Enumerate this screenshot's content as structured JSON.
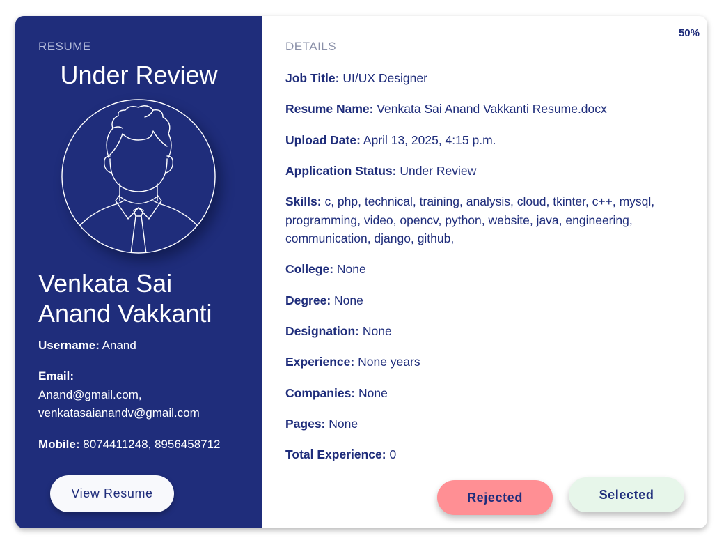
{
  "left_panel": {
    "section_label": "RESUME",
    "status_title": "Under Review",
    "avatar_icon": "person-avatar-icon",
    "full_name": "Venkata Sai Anand Vakkanti",
    "username_label": "Username:",
    "username_value": "Anand",
    "email_label": "Email:",
    "email_value": "Anand@gmail.com, venkatasaianandv@gmail.com",
    "mobile_label": "Mobile:",
    "mobile_value": "8074411248, 8956458712",
    "view_resume_label": "View Resume"
  },
  "right_panel": {
    "percent": "50%",
    "section_label": "DETAILS",
    "details": [
      {
        "label": "Job Title:",
        "value": "UI/UX Designer"
      },
      {
        "label": "Resume Name:",
        "value": "Venkata Sai Anand Vakkanti Resume.docx"
      },
      {
        "label": "Upload Date:",
        "value": "April 13, 2025, 4:15 p.m."
      },
      {
        "label": "Application Status:",
        "value": "Under Review"
      },
      {
        "label": "Skills:",
        "value": "c, php, technical, training, analysis, cloud, tkinter, c++, mysql, programming, video, opencv, python, website, java, engineering, communication, django, github,"
      },
      {
        "label": "College:",
        "value": "None"
      },
      {
        "label": "Degree:",
        "value": "None"
      },
      {
        "label": "Designation:",
        "value": "None"
      },
      {
        "label": "Experience:",
        "value": "None years"
      },
      {
        "label": "Companies:",
        "value": "None"
      },
      {
        "label": "Pages:",
        "value": "None"
      },
      {
        "label": "Total Experience:",
        "value": "0"
      }
    ],
    "rejected_label": "Rejected",
    "selected_label": "Selected"
  },
  "colors": {
    "panel_blue": "#1f2d7b",
    "rejected_bg": "#ff8f94",
    "selected_bg": "#e7f6ea"
  }
}
